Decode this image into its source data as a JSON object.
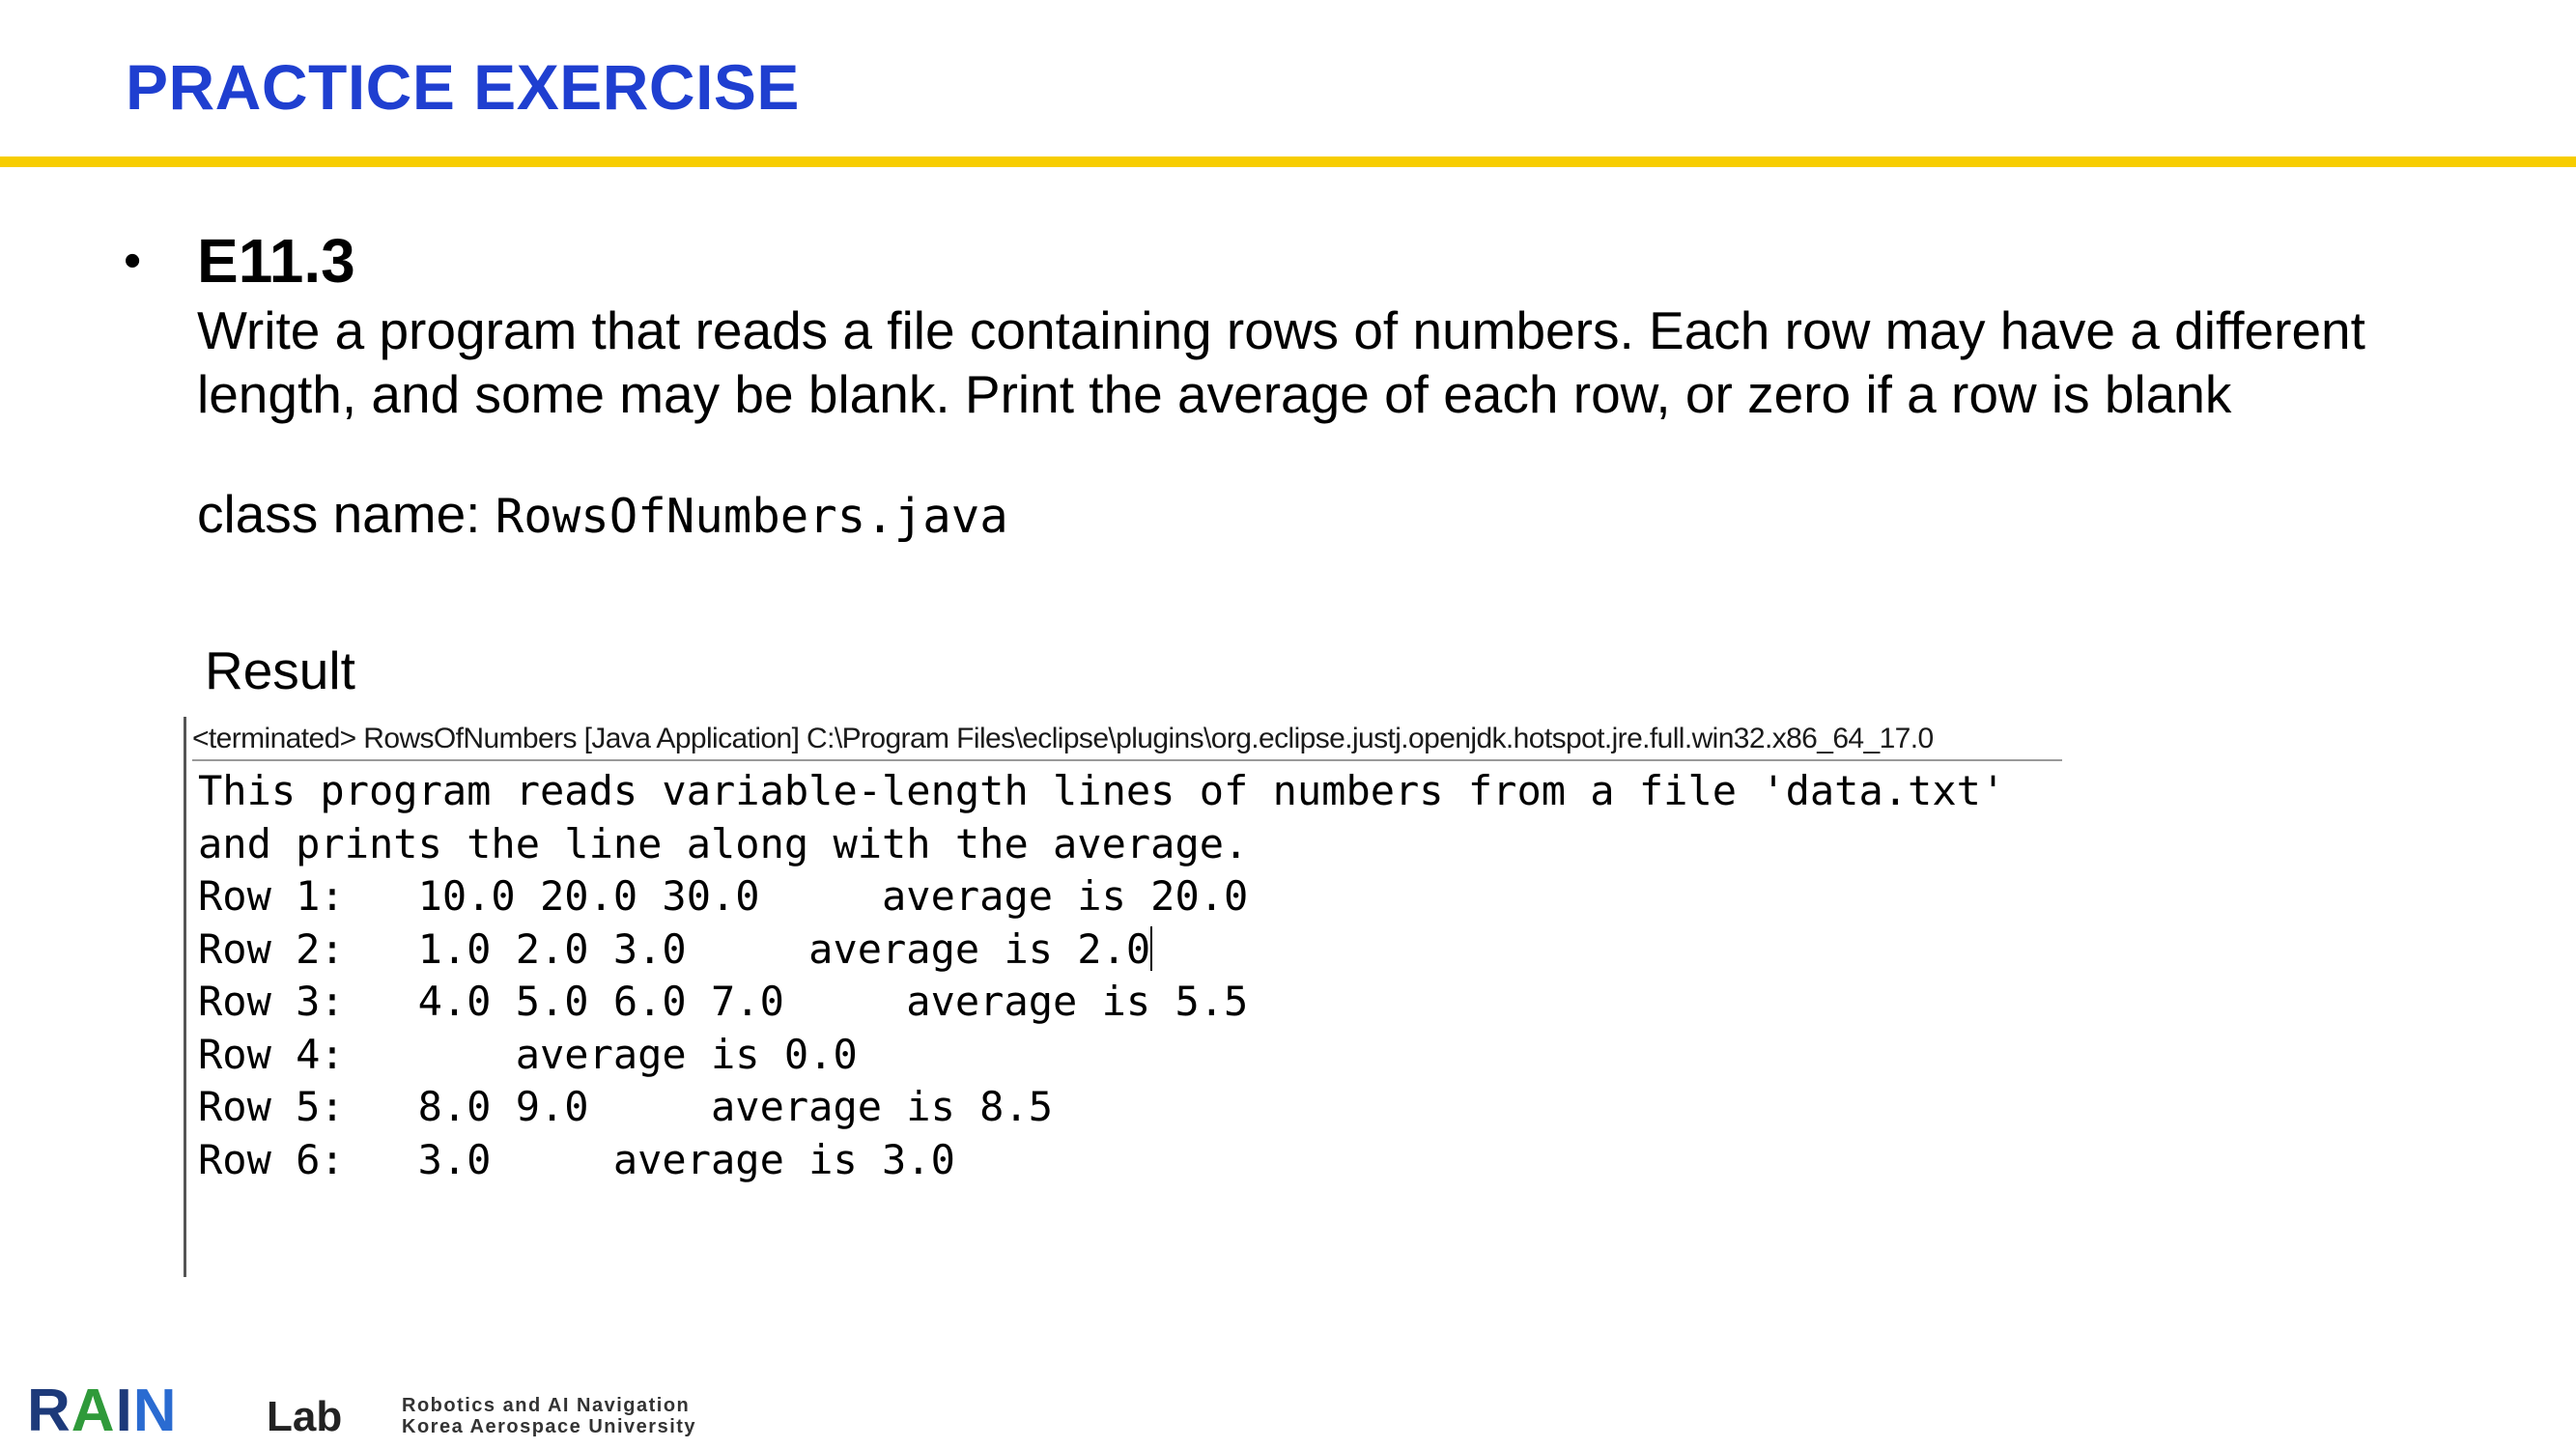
{
  "slide": {
    "title": "PRACTICE EXERCISE",
    "bullet": "•",
    "exercise_id": "E11.3",
    "description_lines": [
      "Write a program that reads a file containing rows of numbers. Each row may have a different",
      "length, and some may be blank. Print the average of each row, or zero if a row is blank"
    ],
    "class_label": "class name: ",
    "class_name": "RowsOfNumbers.java",
    "result_label": "Result"
  },
  "console": {
    "header": "<terminated> RowsOfNumbers [Java Application] C:\\Program Files\\eclipse\\plugins\\org.eclipse.justj.openjdk.hotspot.jre.full.win32.x86_64_17.0",
    "lines": [
      "This program reads variable-length lines of numbers from a file 'data.txt'",
      "and prints the line along with the average.",
      "Row 1:   10.0 20.0 30.0     average is 20.0",
      "Row 2:   1.0 2.0 3.0     average is 2.0",
      "Row 3:   4.0 5.0 6.0 7.0     average is 5.5",
      "Row 4:       average is 0.0",
      "Row 5:   8.0 9.0     average is 8.5",
      "Row 6:   3.0     average is 3.0"
    ]
  },
  "logo": {
    "brand": "RAIN",
    "lab": "Lab",
    "tagline_1": "Robotics and AI Navigation",
    "tagline_2": "Korea Aerospace University",
    "colors": {
      "navy": "#1d3a7a",
      "green": "#2f9a3a",
      "blue": "#2a6bd1"
    }
  },
  "colors": {
    "title": "#1f3fd0",
    "rule": "#f7cd00"
  }
}
